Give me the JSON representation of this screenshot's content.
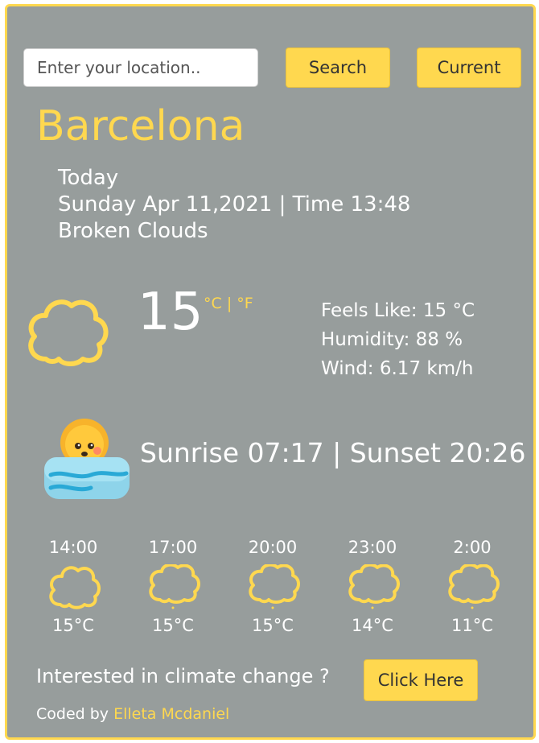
{
  "search": {
    "placeholder": "Enter your location..",
    "search_label": "Search",
    "current_label": "Current"
  },
  "location": {
    "city": "Barcelona",
    "day_label": "Today",
    "datetime": "Sunday Apr 11,2021 | Time 13:48",
    "description": "Broken Clouds"
  },
  "current": {
    "temperature": "15",
    "unit_c": "°C",
    "unit_sep": " | ",
    "unit_f": "°F",
    "feels_like": "Feels Like: 15 °C",
    "humidity": "Humidity: 88 %",
    "wind": "Wind: 6.17 km/h",
    "icon": "cloud-icon"
  },
  "sun": {
    "text": "Sunrise 07:17 | Sunset 20:26",
    "icon": "sunrise-icon"
  },
  "forecast": [
    {
      "time": "14:00",
      "temp": "15°C",
      "icon": "cloud-icon"
    },
    {
      "time": "17:00",
      "temp": "15°C",
      "icon": "cloud-rain-icon"
    },
    {
      "time": "20:00",
      "temp": "15°C",
      "icon": "cloud-rain-icon"
    },
    {
      "time": "23:00",
      "temp": "14°C",
      "icon": "cloud-rain-icon"
    },
    {
      "time": "2:00",
      "temp": "11°C",
      "icon": "cloud-rain-icon"
    }
  ],
  "climate": {
    "question": "Interested in climate change ?",
    "button_label": "Click Here"
  },
  "footer": {
    "prefix": "Coded by ",
    "author": "Elleta Mcdaniel"
  },
  "colors": {
    "accent": "#ffd84f",
    "background": "#979d9c",
    "text": "#ffffff"
  }
}
